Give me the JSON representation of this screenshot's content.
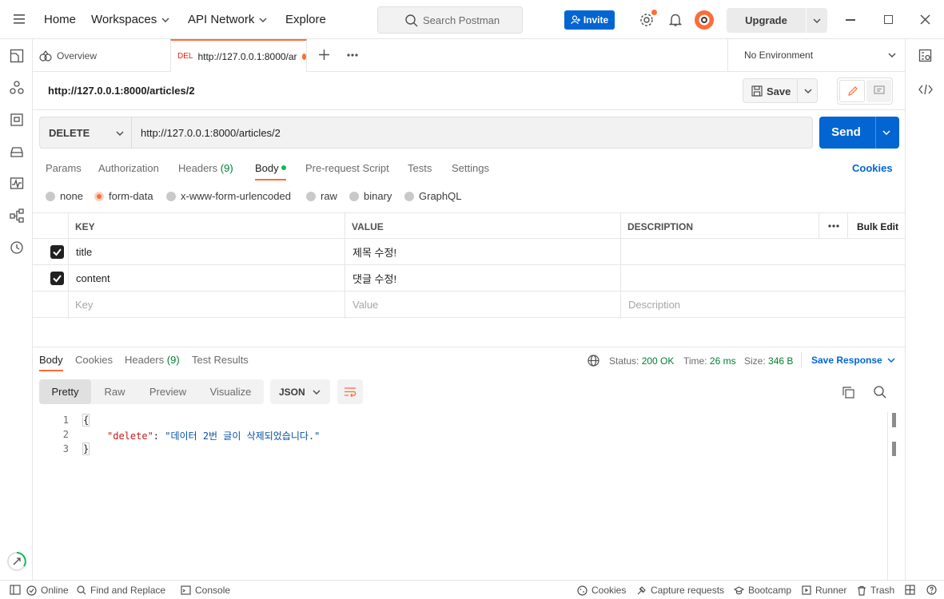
{
  "header": {
    "home": "Home",
    "workspaces": "Workspaces",
    "api_network": "API Network",
    "explore": "Explore",
    "search_placeholder": "Search Postman",
    "invite": "Invite",
    "upgrade": "Upgrade"
  },
  "tabs": {
    "overview": "Overview",
    "active_method": "DEL",
    "active_title": "http://127.0.0.1:8000/ar",
    "environment": "No Environment"
  },
  "request": {
    "title": "http://127.0.0.1:8000/articles/2",
    "save": "Save",
    "method": "DELETE",
    "url": "http://127.0.0.1:8000/articles/2",
    "send": "Send"
  },
  "subtabs": {
    "params": "Params",
    "authorization": "Authorization",
    "headers": "Headers",
    "headers_count": "(9)",
    "body": "Body",
    "prerequest": "Pre-request Script",
    "tests": "Tests",
    "settings": "Settings",
    "cookies": "Cookies"
  },
  "body_types": {
    "none": "none",
    "form_data": "form-data",
    "urlencoded": "x-www-form-urlencoded",
    "raw": "raw",
    "binary": "binary",
    "graphql": "GraphQL"
  },
  "params_table": {
    "col_key": "KEY",
    "col_value": "VALUE",
    "col_description": "DESCRIPTION",
    "bulk_edit": "Bulk Edit",
    "rows": [
      {
        "key": "title",
        "value": "제목 수정!",
        "checked": true
      },
      {
        "key": "content",
        "value": "댓글 수정!",
        "checked": true
      }
    ],
    "placeholder_key": "Key",
    "placeholder_value": "Value",
    "placeholder_description": "Description"
  },
  "response": {
    "tabs": {
      "body": "Body",
      "cookies": "Cookies",
      "headers": "Headers",
      "headers_count": "(9)",
      "test_results": "Test Results"
    },
    "status_label": "Status:",
    "status_value": "200 OK",
    "time_label": "Time:",
    "time_value": "26 ms",
    "size_label": "Size:",
    "size_value": "346 B",
    "save_response": "Save Response",
    "views": {
      "pretty": "Pretty",
      "raw": "Raw",
      "preview": "Preview",
      "visualize": "Visualize"
    },
    "format": "JSON",
    "lines": {
      "n1": "1",
      "n2": "2",
      "n3": "3",
      "open_brace": "{",
      "key": "\"delete\"",
      "colon": ": ",
      "value": "\"데이터 2번 글이 삭제되었습니다.\"",
      "close_brace": "}"
    }
  },
  "statusbar": {
    "online": "Online",
    "find_replace": "Find and Replace",
    "console": "Console",
    "cookies": "Cookies",
    "capture": "Capture requests",
    "bootcamp": "Bootcamp",
    "runner": "Runner",
    "trash": "Trash"
  },
  "colors": {
    "accent_blue": "#0265d2",
    "accent_orange": "#ff6c37",
    "status_green": "#007f31",
    "body_dot_green": "#0cbb52"
  }
}
